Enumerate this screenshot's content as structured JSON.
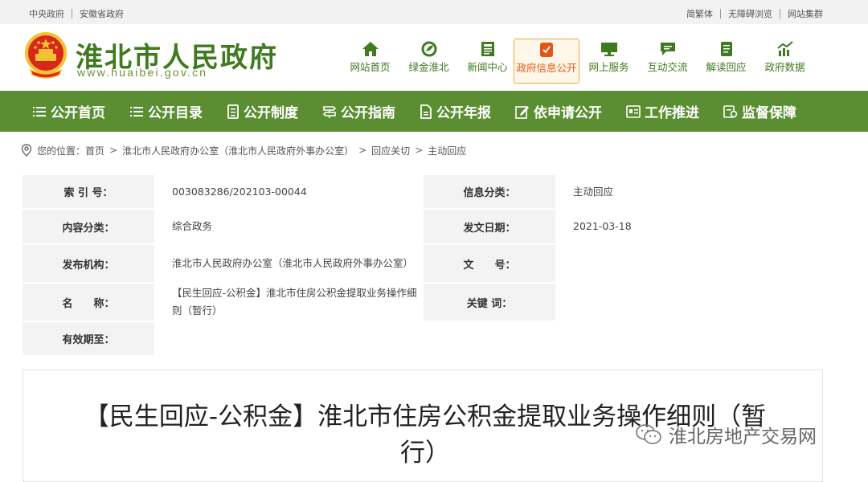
{
  "topbar": {
    "left_links": [
      "中央政府",
      "安徽省政府"
    ],
    "right_links": [
      "简繁体",
      "无障碍浏览",
      "网站集群"
    ]
  },
  "header": {
    "site_name": "淮北市人民政府",
    "site_url": "www.huaibei.gov.cn",
    "nav": [
      {
        "label": "网站首页",
        "icon": "home-icon"
      },
      {
        "label": "绿金淮北",
        "icon": "leaf-icon"
      },
      {
        "label": "新闻中心",
        "icon": "newspaper-icon"
      },
      {
        "label": "政府信息公开",
        "icon": "clipboard-check-icon",
        "active": true
      },
      {
        "label": "网上服务",
        "icon": "monitor-icon"
      },
      {
        "label": "互动交流",
        "icon": "chat-icon"
      },
      {
        "label": "解读回应",
        "icon": "document-icon"
      },
      {
        "label": "政府数据",
        "icon": "chart-icon"
      }
    ]
  },
  "menubar": [
    {
      "label": "公开首页",
      "icon": "list-icon"
    },
    {
      "label": "公开目录",
      "icon": "list-icon"
    },
    {
      "label": "公开制度",
      "icon": "doc-icon"
    },
    {
      "label": "公开指南",
      "icon": "signpost-icon"
    },
    {
      "label": "公开年报",
      "icon": "file-icon"
    },
    {
      "label": "依申请公开",
      "icon": "edit-icon"
    },
    {
      "label": "工作推进",
      "icon": "card-icon"
    },
    {
      "label": "监督保障",
      "icon": "shield-icon"
    }
  ],
  "breadcrumb": {
    "prefix": "您的位置：",
    "items": [
      "首页",
      "淮北市人民政府办公室（淮北市人民政府外事办公室）",
      "回应关切",
      "主动回应"
    ]
  },
  "info": {
    "index_label": "索 引 号：",
    "index_value": "003083286/202103-00044",
    "category_label": "信息分类：",
    "category_value": "主动回应",
    "content_label": "内容分类：",
    "content_value": "综合政务",
    "date_label": "发文日期：",
    "date_value": "2021-03-18",
    "org_label": "发布机构：",
    "org_value": "淮北市人民政府办公室（淮北市人民政府外事办公室）",
    "docno_label": "文　　号：",
    "docno_value": "",
    "name_label": "名　　称：",
    "name_value": "【民生回应-公积金】淮北市住房公积金提取业务操作细则（暂行）",
    "keyword_label": "关键 词：",
    "keyword_value": "",
    "valid_label": "有效期至：",
    "valid_value": ""
  },
  "article": {
    "title": "【民生回应-公积金】淮北市住房公积金提取业务操作细则（暂行）"
  },
  "watermark": "淮北房地产交易网",
  "colors": {
    "brand_green": "#5b8e32",
    "title_green": "#3f7a1f",
    "active_orange": "#e8540f"
  }
}
